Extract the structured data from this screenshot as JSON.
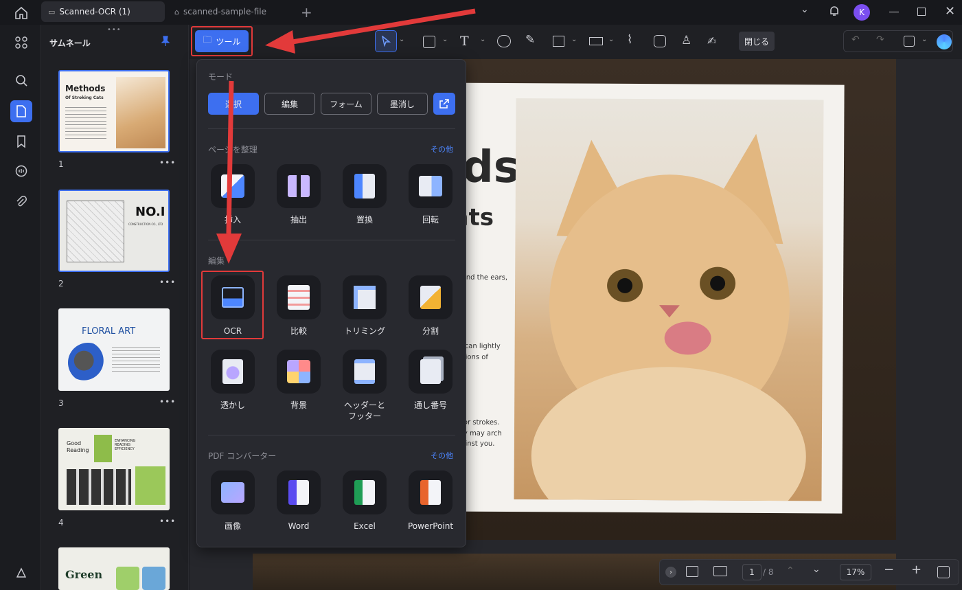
{
  "titlebar": {
    "tabs": [
      {
        "label": "Scanned-OCR (1)",
        "active": true
      },
      {
        "label": "scanned-sample-file",
        "active": false
      }
    ],
    "avatar_initial": "K"
  },
  "thumbnails": {
    "title": "サムネール",
    "pages": [
      {
        "number": "1",
        "text_title": "Methods",
        "text_sub": "Of Stroking Cats"
      },
      {
        "number": "2",
        "text_title": "NO.I",
        "text_sub": "CONSTRUCTION CO., LTD"
      },
      {
        "number": "3",
        "text_title": "FLORAL ART",
        "text_sub": ""
      },
      {
        "number": "4",
        "text_title": "Good Reading",
        "text_sub": "ENHANCING READING EFFICIENCY"
      },
      {
        "number": "",
        "text_title": "Green",
        "text_sub": ""
      }
    ],
    "dots": "•••"
  },
  "toolbar": {
    "tool_button": "ツール",
    "close_button": "閉じる"
  },
  "popup": {
    "mode_label": "モード",
    "modes": [
      "選択",
      "編集",
      "フォーム",
      "墨消し"
    ],
    "page_section": "ページを整理",
    "page_more": "その他",
    "page_tools": [
      "挿入",
      "抽出",
      "置換",
      "回転"
    ],
    "edit_section": "編集",
    "edit_tools": [
      "OCR",
      "比較",
      "トリミング",
      "分割",
      "透かし",
      "背景",
      "ヘッダーと\nフッター",
      "通し番号"
    ],
    "convert_section": "PDF コンバーター",
    "convert_more": "その他",
    "convert_tools": [
      "画像",
      "Word",
      "Excel",
      "PowerPoint"
    ]
  },
  "document": {
    "heading1": "ods",
    "heading2": "Cats",
    "para1": "cially behind the ears,",
    "para2a": "area. You can lightly",
    "para2b": "w expressions of",
    "para3a": "red spot for strokes.",
    "para3b": "hand, they may arch",
    "para3c": "against you."
  },
  "statusbar": {
    "page_current": "1",
    "page_total": "/ 8",
    "zoom": "17%"
  },
  "colors": {
    "accent": "#3d6ff0",
    "highlight_red": "#e23a3a",
    "panel_bg": "#28292f"
  }
}
